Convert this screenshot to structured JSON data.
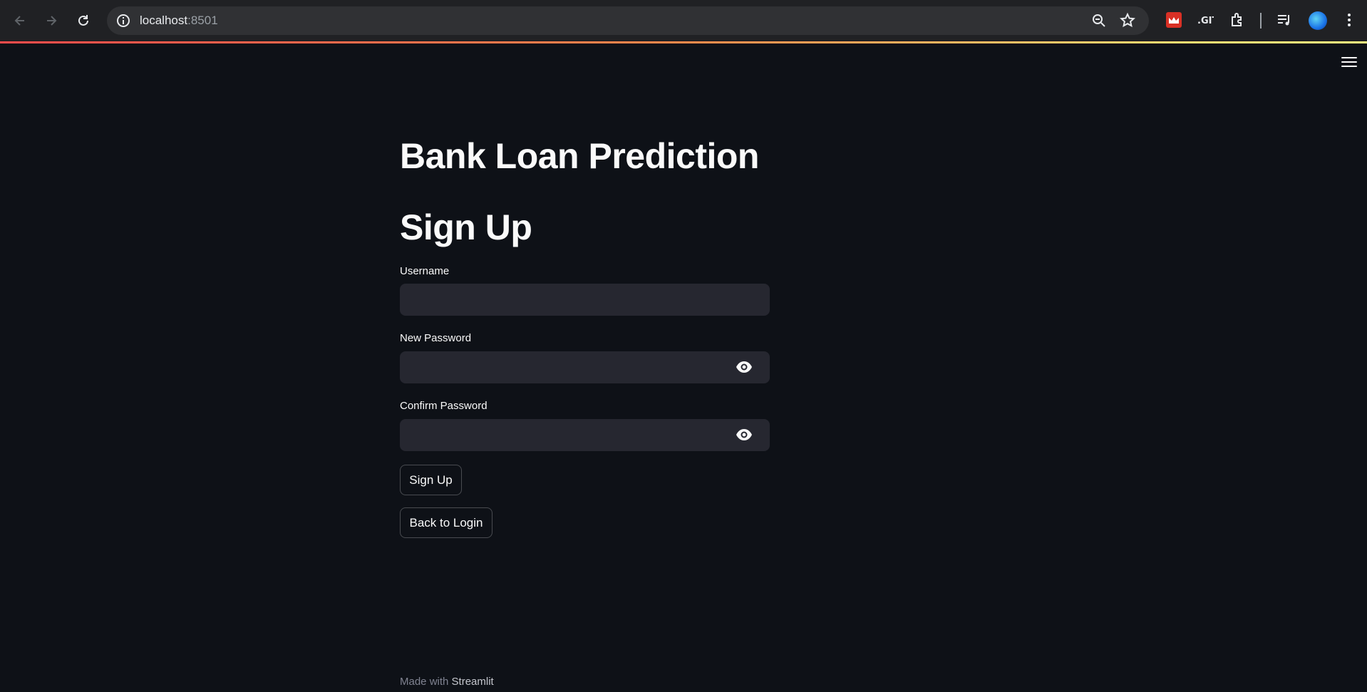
{
  "browser": {
    "url_host": "localhost",
    "url_port": ":8501"
  },
  "page": {
    "title": "Bank Loan Prediction",
    "subtitle": "Sign Up"
  },
  "form": {
    "username_label": "Username",
    "username_value": "",
    "new_password_label": "New Password",
    "new_password_value": "",
    "confirm_password_label": "Confirm Password",
    "confirm_password_value": "",
    "signup_button": "Sign Up",
    "back_button": "Back to Login"
  },
  "footer": {
    "prefix": "Made with ",
    "brand": "Streamlit"
  },
  "colors": {
    "background": "#0e1117",
    "input_bg": "#262730",
    "text": "#fafafa",
    "chrome_bg": "#202124"
  },
  "icons": [
    "back-arrow-icon",
    "forward-arrow-icon",
    "reload-icon",
    "info-icon",
    "zoom-out-icon",
    "star-icon",
    "extension-icon",
    "media-icon",
    "more-icon",
    "menu-icon",
    "eye-icon"
  ]
}
